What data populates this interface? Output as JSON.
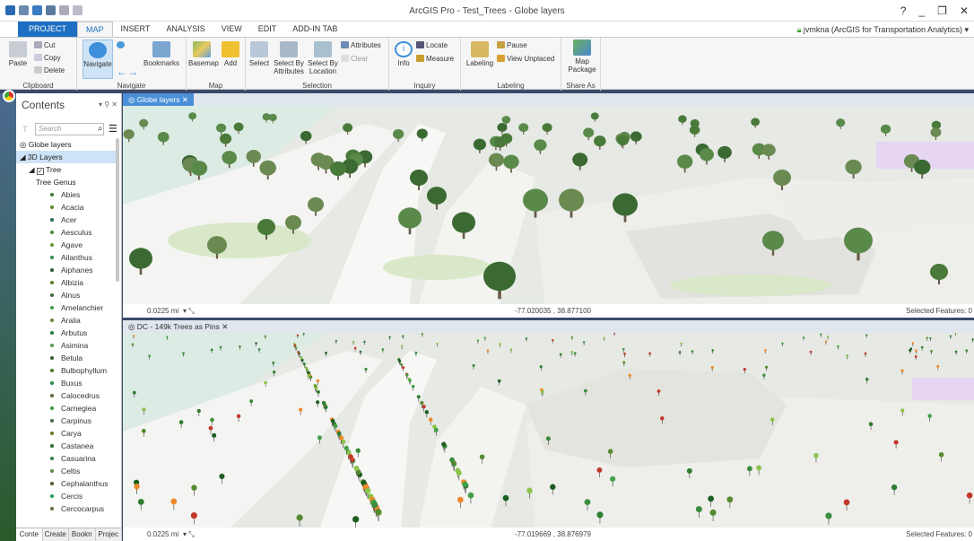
{
  "window": {
    "title": "ArcGIS Pro - Test_Trees - Globe layers",
    "controls": [
      "?",
      "_",
      "❐",
      "✕"
    ]
  },
  "ribbon_tabs": [
    "PROJECT",
    "MAP",
    "INSERT",
    "ANALYSIS",
    "VIEW",
    "EDIT",
    "ADD-IN TAB"
  ],
  "user": "jvmkna (ArcGIS for Transportation Analytics) ▾",
  "ribbon": {
    "clipboard": {
      "paste": "Paste",
      "cut": "Cut",
      "copy": "Copy",
      "delete": "Delete",
      "label": "Clipboard"
    },
    "navigate": {
      "navigate": "Navigate",
      "bookmarks": "Bookmarks",
      "label": "Navigate"
    },
    "map": {
      "basemap": "Basemap",
      "add": "Add",
      "label": "Map"
    },
    "selection": {
      "select": "Select",
      "select_by_attributes": "Select By Attributes",
      "select_by_location": "Select By Location",
      "attributes": "Attributes",
      "clear": "Clear",
      "label": "Selection"
    },
    "inquiry": {
      "info": "Info",
      "locate": "Locate",
      "measure": "Measure",
      "label": "Inquiry"
    },
    "labeling": {
      "labeling": "Labeling",
      "pause": "Pause",
      "view_unplaced": "View Unplaced",
      "label": "Labeling"
    },
    "share": {
      "map_package": "Map Package",
      "label": "Share As"
    }
  },
  "contents": {
    "title": "Contents",
    "search_placeholder": "Search",
    "items": [
      {
        "label": "Globe layers"
      },
      {
        "label": "3D Layers"
      },
      {
        "label": "Tree"
      },
      {
        "label": "Tree Genus"
      }
    ],
    "genera": [
      "Abies",
      "Acacia",
      "Acer",
      "Aesculus",
      "Agave",
      "Ailanthus",
      "Aiphanes",
      "Albizia",
      "Alnus",
      "Amelanchier",
      "Aralia",
      "Arbutus",
      "Asimina",
      "Betula",
      "Bulbophyllum",
      "Buxus",
      "Calocedrus",
      "Carnegiea",
      "Carpinus",
      "Carya",
      "Castanea",
      "Casuarina",
      "Celtis",
      "Cephalanthus",
      "Cercis",
      "Cercocarpus"
    ],
    "genus_colors": [
      "#3a7a3a",
      "#5a8a2a",
      "#2a6a4a",
      "#4a8a3a",
      "#6a9a3a",
      "#3a8a5a",
      "#2a5a3a",
      "#5a7a2a",
      "#3a6a3a",
      "#4a9a4a",
      "#6a8a3a",
      "#2a7a3a",
      "#5a9a5a",
      "#3a5a3a",
      "#4a7a2a",
      "#2a8a4a",
      "#5a6a3a",
      "#3a9a3a",
      "#4a6a4a",
      "#6a7a2a",
      "#2a6a2a",
      "#3a7a4a",
      "#5a8a4a",
      "#4a5a2a",
      "#2a9a5a",
      "#6a6a3a"
    ],
    "bottom_tabs": [
      "Conte",
      "Create",
      "Bookn",
      "Projec"
    ]
  },
  "views": [
    {
      "tab": "Globe layers",
      "scale": "0.0225 mi",
      "coords": "-77.020035 , 38.877100",
      "selected": "Selected Features: 0"
    },
    {
      "tab": "DC - 149k Trees as Pins",
      "scale": "0.0225 mi",
      "coords": "-77.019669 , 38.876979",
      "selected": "Selected Features: 0"
    }
  ]
}
